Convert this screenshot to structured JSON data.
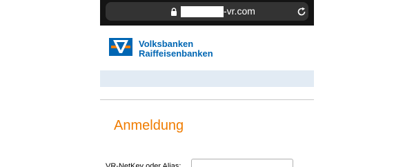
{
  "browser": {
    "url_suffix": "-vr.com",
    "icons": {
      "lock": "lock-icon",
      "reload": "reload-icon"
    }
  },
  "brand": {
    "line1": "Volksbanken",
    "line2": "Raiffeisenbanken",
    "colors": {
      "blue": "#0066b3",
      "orange": "#f07c00"
    }
  },
  "login": {
    "heading": "Anmeldung",
    "netkey_label": "VR-NetKey oder Alias:",
    "netkey_value": ""
  },
  "colors": {
    "heading": "#f07c00",
    "band": "#e2ebf4"
  }
}
